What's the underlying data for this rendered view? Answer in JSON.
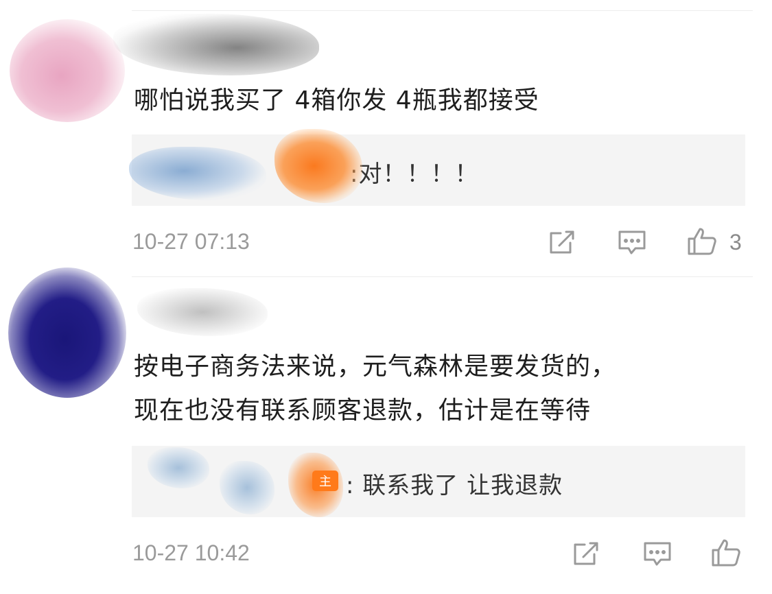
{
  "comments": [
    {
      "text": "哪怕说我买了 4箱你发 4瓶我都接受",
      "reply": {
        "text": ":对！！！！"
      },
      "timestamp": "10-27 07:13",
      "actions": {
        "share_icon": "share-icon",
        "comment_icon": "comment-icon",
        "like_icon": "thumbs-up-icon",
        "like_count": "3"
      }
    },
    {
      "text_lines": [
        "按电子商务法来说，元气森林是要发货的，",
        "现在也没有联系顾客退款，估计是在等待"
      ],
      "reply": {
        "badge": "主",
        "text": ": 联系我了 让我退款"
      },
      "timestamp": "10-27 10:42",
      "actions": {
        "share_icon": "share-icon",
        "comment_icon": "comment-icon",
        "like_icon": "thumbs-up-icon"
      }
    }
  ],
  "colors": {
    "reply_bg": "#f4f4f4",
    "badge_orange": "#ff7a1a",
    "timestamp_gray": "#9a9a9a"
  }
}
